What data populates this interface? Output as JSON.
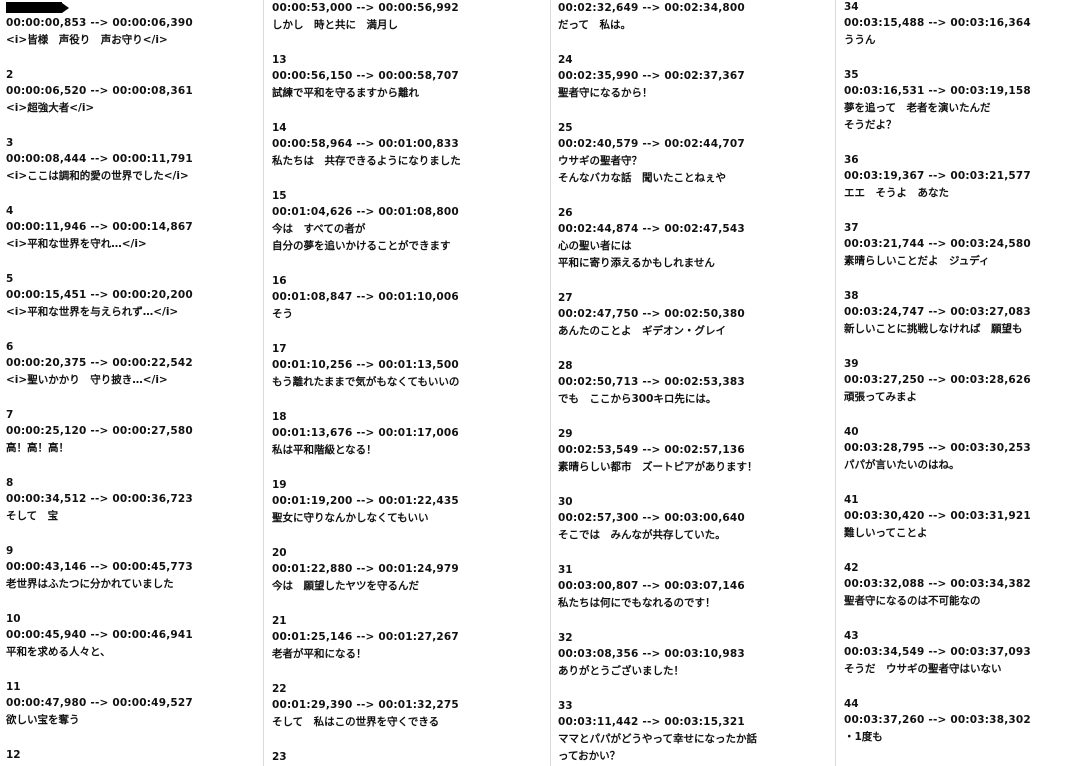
{
  "columns": [
    {
      "cues": [
        {
          "num": "",
          "time": "00:00:00,853 --> 00:00:06,390",
          "lines": [
            "<i>皆様　声役り　声お守り</i>"
          ]
        },
        {
          "num": "2",
          "time": "00:00:06,520 --> 00:00:08,361",
          "lines": [
            "<i>超強大者</i>"
          ]
        },
        {
          "num": "3",
          "time": "00:00:08,444 --> 00:00:11,791",
          "lines": [
            "<i>ここは調和的愛の世界でした</i>"
          ]
        },
        {
          "num": "4",
          "time": "00:00:11,946 --> 00:00:14,867",
          "lines": [
            "<i>平和な世界を守れ…</i>"
          ]
        },
        {
          "num": "5",
          "time": "00:00:15,451 --> 00:00:20,200",
          "lines": [
            "<i>平和な世界を与えられず…</i>"
          ]
        },
        {
          "num": "6",
          "time": "00:00:20,375 --> 00:00:22,542",
          "lines": [
            "<i>聖いかかり　守り披き…</i>"
          ]
        },
        {
          "num": "7",
          "time": "00:00:25,120 --> 00:00:27,580",
          "lines": [
            "高！高！高！"
          ]
        },
        {
          "num": "8",
          "time": "00:00:34,512 --> 00:00:36,723",
          "lines": [
            "そして　宝"
          ]
        },
        {
          "num": "9",
          "time": "00:00:43,146 --> 00:00:45,773",
          "lines": [
            "老世界はふたつに分かれていました"
          ]
        },
        {
          "num": "10",
          "time": "00:00:45,940 --> 00:00:46,941",
          "lines": [
            "平和を求める人々と、"
          ]
        },
        {
          "num": "11",
          "time": "00:00:47,980 --> 00:00:49,527",
          "lines": [
            "欲しい宝を奪う"
          ]
        },
        {
          "num": "12",
          "time": "",
          "lines": []
        }
      ]
    },
    {
      "cues": [
        {
          "num": "",
          "time": "00:00:53,000 --> 00:00:56,992",
          "lines": [
            "しかし　時と共に　満月し"
          ]
        },
        {
          "num": "13",
          "time": "00:00:56,150 --> 00:00:58,707",
          "lines": [
            "試練で平和を守るますから離れ"
          ]
        },
        {
          "num": "14",
          "time": "00:00:58,964 --> 00:01:00,833",
          "lines": [
            "私たちは　共存できるようになりました"
          ]
        },
        {
          "num": "15",
          "time": "00:01:04,626 --> 00:01:08,800",
          "lines": [
            "今は　すべての者が",
            "自分の夢を追いかけることができます"
          ]
        },
        {
          "num": "16",
          "time": "00:01:08,847 --> 00:01:10,006",
          "lines": [
            "そう"
          ]
        },
        {
          "num": "17",
          "time": "00:01:10,256 --> 00:01:13,500",
          "lines": [
            "もう離れたままで気がもなくてもいいの"
          ]
        },
        {
          "num": "18",
          "time": "00:01:13,676 --> 00:01:17,006",
          "lines": [
            "私は平和階級となる！"
          ]
        },
        {
          "num": "19",
          "time": "00:01:19,200 --> 00:01:22,435",
          "lines": [
            "聖女に守りなんかしなくてもいい"
          ]
        },
        {
          "num": "20",
          "time": "00:01:22,880 --> 00:01:24,979",
          "lines": [
            "今は　願望したヤツを守るんだ"
          ]
        },
        {
          "num": "21",
          "time": "00:01:25,146 --> 00:01:27,267",
          "lines": [
            "老者が平和になる！"
          ]
        },
        {
          "num": "22",
          "time": "00:01:29,390 --> 00:01:32,275",
          "lines": [
            "そして　私はこの世界を守くできる"
          ]
        },
        {
          "num": "23",
          "time": "",
          "lines": []
        }
      ]
    },
    {
      "cues": [
        {
          "num": "",
          "time": "00:02:32,649 --> 00:02:34,800",
          "lines": [
            "だって　私は。"
          ]
        },
        {
          "num": "24",
          "time": "00:02:35,990 --> 00:02:37,367",
          "lines": [
            "聖者守になるから！"
          ]
        },
        {
          "num": "25",
          "time": "00:02:40,579 --> 00:02:44,707",
          "lines": [
            "ウサギの聖者守？",
            "そんなバカな話　聞いたことねぇや"
          ]
        },
        {
          "num": "26",
          "time": "00:02:44,874 --> 00:02:47,543",
          "lines": [
            "心の聖い者には",
            "平和に寄り添えるかもしれません"
          ]
        },
        {
          "num": "27",
          "time": "00:02:47,750 --> 00:02:50,380",
          "lines": [
            "あんたのことよ　ギデオン・グレイ"
          ]
        },
        {
          "num": "28",
          "time": "00:02:50,713 --> 00:02:53,383",
          "lines": [
            "でも　ここから300キロ先には。"
          ]
        },
        {
          "num": "29",
          "time": "00:02:53,549 --> 00:02:57,136",
          "lines": [
            "素晴らしい都市　ズートピアがあります！"
          ]
        },
        {
          "num": "30",
          "time": "00:02:57,300 --> 00:03:00,640",
          "lines": [
            "そこでは　みんなが共存していた。"
          ]
        },
        {
          "num": "31",
          "time": "00:03:00,807 --> 00:03:07,146",
          "lines": [
            "私たちは何にでもなれるのです！"
          ]
        },
        {
          "num": "32",
          "time": "00:03:08,356 --> 00:03:10,983",
          "lines": [
            "ありがとうございました！"
          ]
        },
        {
          "num": "33",
          "time": "00:03:11,442 --> 00:03:15,321",
          "lines": [
            "ママとパパがどうやって幸せになったか話",
            "っておかい？"
          ]
        }
      ]
    },
    {
      "cues": [
        {
          "num": "34",
          "time": "00:03:15,488 --> 00:03:16,364",
          "lines": [
            "ううん"
          ]
        },
        {
          "num": "35",
          "time": "00:03:16,531 --> 00:03:19,158",
          "lines": [
            "夢を追って　老者を演いたんだ",
            "そうだよ？"
          ]
        },
        {
          "num": "36",
          "time": "00:03:19,367 --> 00:03:21,577",
          "lines": [
            "エエ　そうよ　あなた"
          ]
        },
        {
          "num": "37",
          "time": "00:03:21,744 --> 00:03:24,580",
          "lines": [
            "素晴らしいことだよ　ジュディ"
          ]
        },
        {
          "num": "38",
          "time": "00:03:24,747 --> 00:03:27,083",
          "lines": [
            "新しいことに挑戦しなければ　願望も"
          ]
        },
        {
          "num": "39",
          "time": "00:03:27,250 --> 00:03:28,626",
          "lines": [
            "頑張ってみまよ"
          ]
        },
        {
          "num": "40",
          "time": "00:03:28,795 --> 00:03:30,253",
          "lines": [
            "パパが言いたいのはね。"
          ]
        },
        {
          "num": "41",
          "time": "00:03:30,420 --> 00:03:31,921",
          "lines": [
            "難しいってことよ"
          ]
        },
        {
          "num": "42",
          "time": "00:03:32,088 --> 00:03:34,382",
          "lines": [
            "聖者守になるのは不可能なの"
          ]
        },
        {
          "num": "43",
          "time": "00:03:34,549 --> 00:03:37,093",
          "lines": [
            "そうだ　ウサギの聖者守はいない"
          ]
        },
        {
          "num": "44",
          "time": "00:03:37,260 --> 00:03:38,302",
          "lines": [
            "・1度も"
          ]
        }
      ]
    }
  ]
}
